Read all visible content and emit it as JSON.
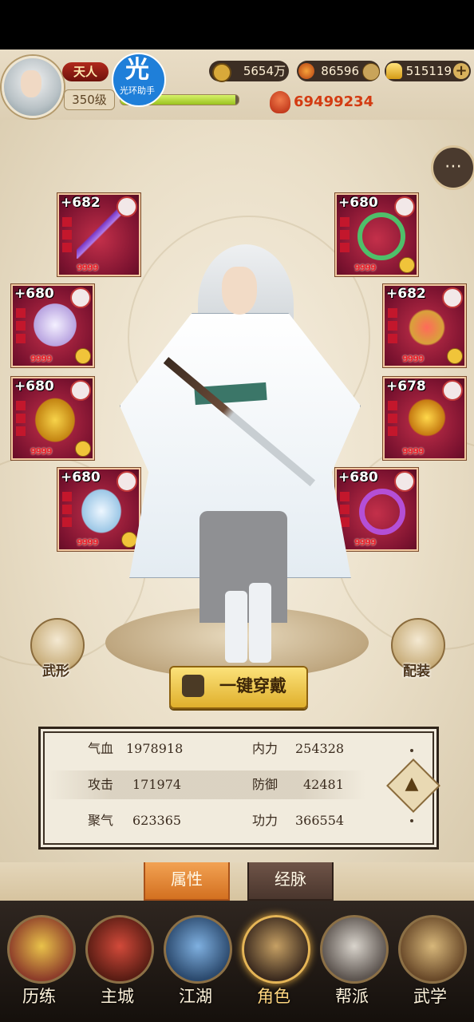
{
  "header": {
    "rank_badge": "天人",
    "level": "350级",
    "helper_glyph": "光",
    "helper_label": "光环助手",
    "exp_fraction": 0.97,
    "currencies": [
      {
        "name": "coin-icon",
        "value": "5654万"
      },
      {
        "name": "flame-icon",
        "value": "86596"
      },
      {
        "name": "ingot-icon",
        "value": "515119"
      }
    ],
    "combat_power": "69499234"
  },
  "equipment": {
    "left": [
      {
        "level": "+682",
        "stars": "9999",
        "item": "dagger-icon"
      },
      {
        "level": "+680",
        "stars": "9999",
        "item": "robe-icon"
      },
      {
        "level": "+680",
        "stars": "9999",
        "item": "belt-icon"
      },
      {
        "level": "+680",
        "stars": "9999",
        "item": "boots-icon"
      }
    ],
    "right": [
      {
        "level": "+680",
        "stars": "9999",
        "item": "necklace-icon"
      },
      {
        "level": "+682",
        "stars": "9999",
        "item": "pendant-icon"
      },
      {
        "level": "+678",
        "stars": "9999",
        "item": "bracelet-icon"
      },
      {
        "level": "+680",
        "stars": "9999",
        "item": "ring-icon"
      }
    ]
  },
  "buttons": {
    "appearance": "武形",
    "loadout": "配装",
    "equip_all": "一键穿戴"
  },
  "stats": [
    {
      "name": "气血",
      "value": "1978918"
    },
    {
      "name": "内力",
      "value": "254328"
    },
    {
      "name": "攻击",
      "value": "171974"
    },
    {
      "name": "防御",
      "value": "42481"
    },
    {
      "name": "聚气",
      "value": "623365"
    },
    {
      "name": "功力",
      "value": "366554"
    }
  ],
  "tabs": [
    "属性",
    "经脉"
  ],
  "nav": [
    {
      "label": "历练",
      "active": false
    },
    {
      "label": "主城",
      "active": false
    },
    {
      "label": "江湖",
      "active": false
    },
    {
      "label": "角色",
      "active": true
    },
    {
      "label": "帮派",
      "active": false
    },
    {
      "label": "武学",
      "active": false
    }
  ],
  "colors": {
    "accent": "#e0a842",
    "slot": "#7d1330",
    "power": "#d33b12"
  }
}
